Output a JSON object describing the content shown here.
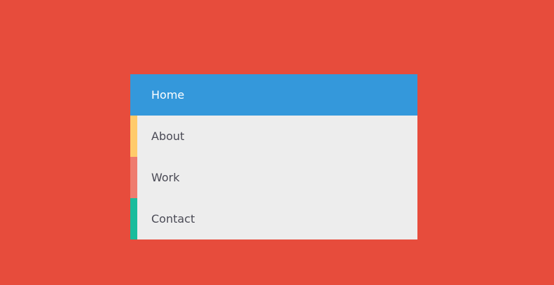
{
  "page": {
    "background_color": "#E74C3C"
  },
  "menu": {
    "items": [
      {
        "label": "Home",
        "active": true,
        "background_color": "#3498DB",
        "text_color": "#FFFFFF",
        "accent_color": ""
      },
      {
        "label": "About",
        "active": false,
        "background_color": "#EDEDED",
        "text_color": "#4A4A55",
        "accent_color": "#FFCB6B"
      },
      {
        "label": "Work",
        "active": false,
        "background_color": "#EDEDED",
        "text_color": "#4A4A55",
        "accent_color": "#EF7B6E"
      },
      {
        "label": "Contact",
        "active": false,
        "background_color": "#EDEDED",
        "text_color": "#4A4A55",
        "accent_color": "#1ABC9C"
      }
    ]
  }
}
